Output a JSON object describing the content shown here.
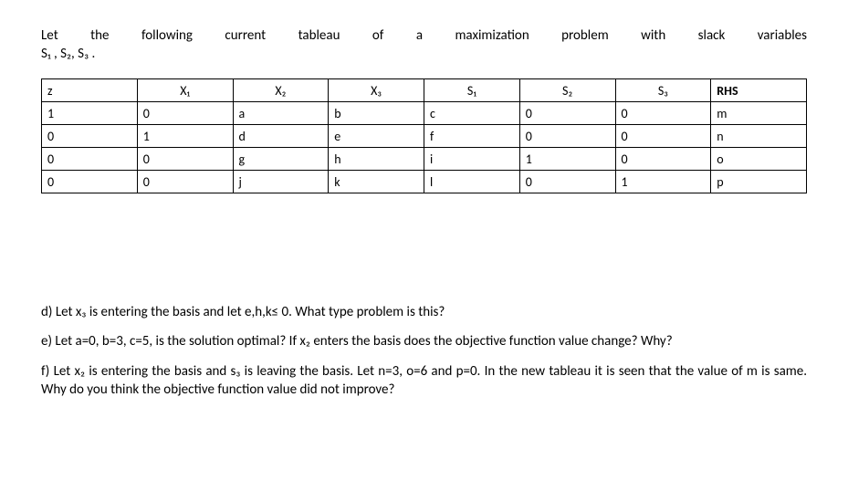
{
  "intro": {
    "line1_prefix": "Let the following current tableau of a maximization problem with slack variables",
    "line2": "S₁ , S₂, S₃ ."
  },
  "table": {
    "headers": [
      "z",
      "X₁",
      "X₂",
      "X₃",
      "S₁",
      "S₂",
      "S₃",
      "RHS"
    ],
    "rows": [
      [
        "1",
        "0",
        "a",
        "b",
        "c",
        "0",
        "0",
        "m"
      ],
      [
        "0",
        "1",
        "d",
        "e",
        "f",
        "0",
        "0",
        "n"
      ],
      [
        "0",
        "0",
        "g",
        "h",
        "i",
        "1",
        "0",
        "o"
      ],
      [
        "0",
        "0",
        "j",
        "k",
        "l",
        "0",
        "1",
        "p"
      ]
    ]
  },
  "questions": {
    "d": "d) Let x₃ is entering the basis and let e,h,k≤ 0. What type problem is this?",
    "e": "e) Let a=0, b=3, c=5, is the solution optimal? If x₂ enters the basis does the objective function value change? Why?",
    "f": "f) Let x₂ is entering the basis and s₃ is leaving the basis. Let n=3, o=6 and p=0. In the new tableau it is seen that the value of m is same. Why do you think the objective function value did not improve?"
  }
}
